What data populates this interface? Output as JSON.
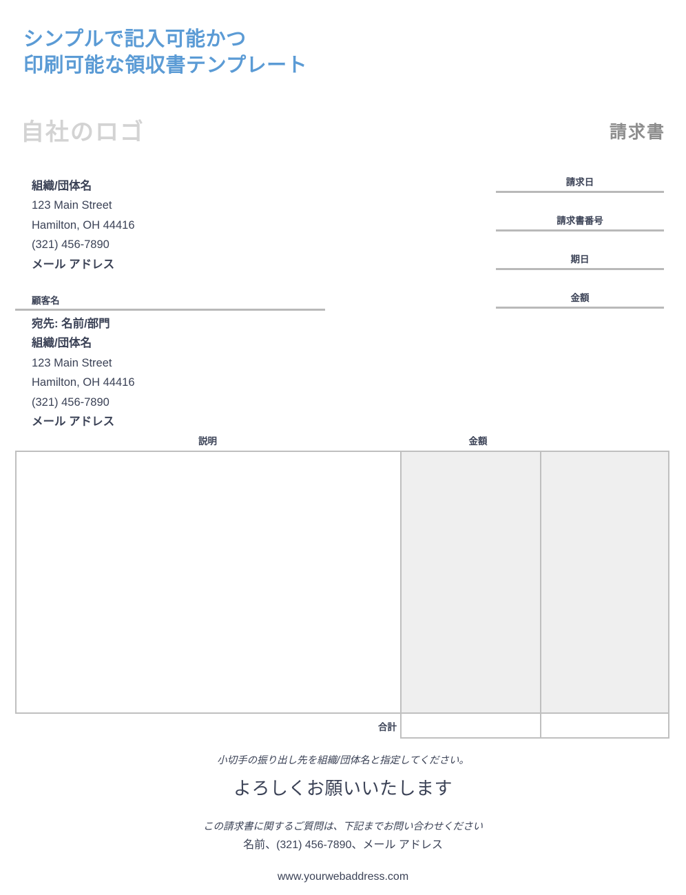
{
  "headline": {
    "line1": "シンプルで記入可能かつ",
    "line2": "印刷可能な領収書テンプレート",
    "color": "#5b9bd5"
  },
  "header": {
    "logo_placeholder": "自社のロゴ",
    "document_title": "請求書"
  },
  "sender": {
    "lines": [
      "組織/団体名",
      "123 Main Street",
      "Hamilton, OH 44416",
      "(321) 456-7890",
      "メール アドレス"
    ]
  },
  "invoice_fields": [
    {
      "label": "請求日",
      "value": ""
    },
    {
      "label": "請求書番号",
      "value": ""
    },
    {
      "label": "期日",
      "value": ""
    },
    {
      "label": "金額",
      "value": ""
    }
  ],
  "customer": {
    "heading": "顧客名",
    "lines": [
      "宛先: 名前/部門",
      "組織/団体名",
      "123 Main Street",
      "Hamilton, OH 44416",
      "(321) 456-7890",
      "メール アドレス"
    ]
  },
  "items_table": {
    "headers": {
      "description": "説明",
      "amount": "金額"
    },
    "body_rows": [
      {
        "description": "",
        "amount1": "",
        "amount2": ""
      }
    ],
    "total": {
      "label": "合計",
      "value1": "",
      "value2": ""
    },
    "shaded_color": "#efefef",
    "border_color": "#bfbfbf"
  },
  "footer": {
    "payee_note": "小切手の振り出し先を組織/団体名と指定してください。",
    "thanks": "よろしくお願いいたします",
    "questions_intro": "この請求書に関するご質問は、下記までお問い合わせください",
    "contact_line": "名前、(321) 456-7890、メール アドレス",
    "website": "www.yourwebaddress.com"
  }
}
